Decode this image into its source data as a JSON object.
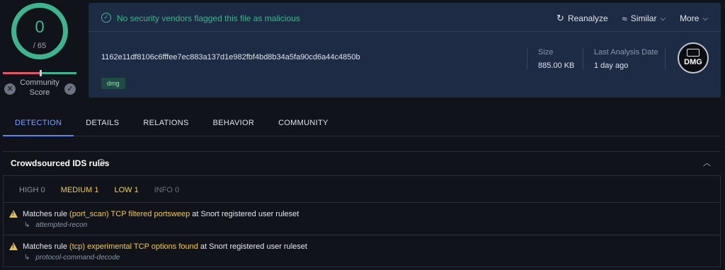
{
  "score": {
    "detections": "0",
    "total": "/ 65",
    "community_label": "Community Score",
    "colors": {
      "clean": "#3fb38f",
      "malicious": "#e0566a"
    }
  },
  "banner": {
    "status_text": "No security vendors flagged this file as malicious",
    "actions": {
      "reanalyze": "Reanalyze",
      "similar": "Similar",
      "more": "More"
    }
  },
  "file": {
    "hash": "1162e11df8106c6fffee7ec883a137d1e982fbf4bd8b34a5fa90cd6a44c4850b",
    "tag": "dmg",
    "size_label": "Size",
    "size_value": "885.00 KB",
    "last_analysis_label": "Last Analysis Date",
    "last_analysis_value": "1 day ago",
    "type_icon_text": "DMG"
  },
  "tabs": [
    {
      "label": "DETECTION",
      "active": true
    },
    {
      "label": "DETAILS"
    },
    {
      "label": "RELATIONS"
    },
    {
      "label": "BEHAVIOR"
    },
    {
      "label": "COMMUNITY"
    }
  ],
  "ids": {
    "title": "Crowdsourced IDS rules",
    "severity": {
      "high": "HIGH 0",
      "medium": "MEDIUM 1",
      "low": "LOW 1",
      "info": "INFO 0"
    },
    "rules": [
      {
        "prefix": "Matches rule",
        "rule": "(port_scan) TCP filtered portsweep",
        "suffix": "at Snort registered user ruleset",
        "category": "attempted-recon"
      },
      {
        "prefix": "Matches rule",
        "rule": "(tcp) experimental TCP options found",
        "suffix": "at Snort registered user ruleset",
        "category": "protocol-command-decode"
      }
    ]
  }
}
